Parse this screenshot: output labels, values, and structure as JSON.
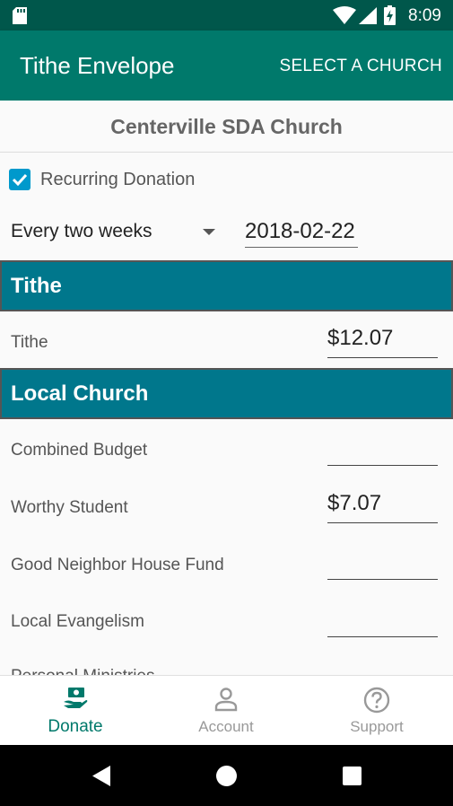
{
  "status_bar": {
    "time": "8:09"
  },
  "app_bar": {
    "title": "Tithe Envelope",
    "action_label": "SELECT A CHURCH"
  },
  "church": {
    "name": "Centerville SDA Church"
  },
  "recurring": {
    "checked": true,
    "label": "Recurring Donation",
    "frequency": "Every two weeks",
    "date": "2018-02-22"
  },
  "sections": [
    {
      "title": "Tithe",
      "rows": [
        {
          "label": "Tithe",
          "amount": "$12.07"
        }
      ]
    },
    {
      "title": "Local Church",
      "rows": [
        {
          "label": "Combined Budget",
          "amount": ""
        },
        {
          "label": "Worthy Student",
          "amount": "$7.07"
        },
        {
          "label": "Good Neighbor House Fund",
          "amount": ""
        },
        {
          "label": "Local Evangelism",
          "amount": ""
        },
        {
          "label": "Personal Ministries",
          "amount": ""
        }
      ]
    }
  ],
  "bottom_nav": [
    {
      "label": "Donate",
      "icon": "donate-icon",
      "active": true,
      "color": "#00796B"
    },
    {
      "label": "Account",
      "icon": "account-icon",
      "active": false,
      "color": "#999999"
    },
    {
      "label": "Support",
      "icon": "help-icon",
      "active": false,
      "color": "#999999"
    }
  ],
  "colors": {
    "app_bar": "#00796B",
    "status_bar": "#00574B",
    "section_header": "#00778C",
    "checkbox": "#0099CC"
  }
}
